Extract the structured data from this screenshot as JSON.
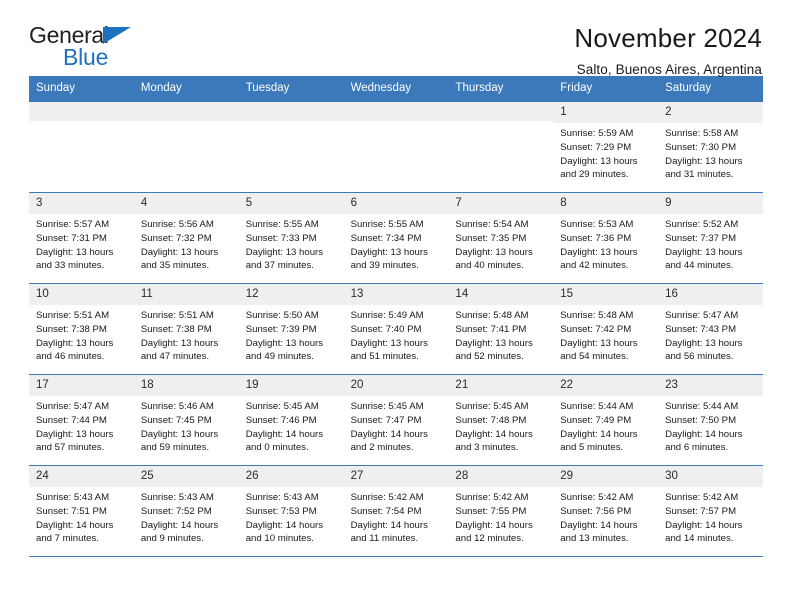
{
  "logo": {
    "line1": "General",
    "line2": "Blue",
    "triangle_color": "#1e72bd"
  },
  "header": {
    "title": "November 2024",
    "location": "Salto, Buenos Aires, Argentina"
  },
  "theme": {
    "header_bg": "#3b79ba",
    "daynum_bg": "#efefef",
    "rule_color": "#3b79ba"
  },
  "calendar": {
    "weekday_headers": [
      "Sunday",
      "Monday",
      "Tuesday",
      "Wednesday",
      "Thursday",
      "Friday",
      "Saturday"
    ],
    "weeks": [
      [
        {
          "day": "",
          "empty": true
        },
        {
          "day": "",
          "empty": true
        },
        {
          "day": "",
          "empty": true
        },
        {
          "day": "",
          "empty": true
        },
        {
          "day": "",
          "empty": true
        },
        {
          "day": "1",
          "sunrise": "Sunrise: 5:59 AM",
          "sunset": "Sunset: 7:29 PM",
          "daylight": "Daylight: 13 hours and 29 minutes."
        },
        {
          "day": "2",
          "sunrise": "Sunrise: 5:58 AM",
          "sunset": "Sunset: 7:30 PM",
          "daylight": "Daylight: 13 hours and 31 minutes."
        }
      ],
      [
        {
          "day": "3",
          "sunrise": "Sunrise: 5:57 AM",
          "sunset": "Sunset: 7:31 PM",
          "daylight": "Daylight: 13 hours and 33 minutes."
        },
        {
          "day": "4",
          "sunrise": "Sunrise: 5:56 AM",
          "sunset": "Sunset: 7:32 PM",
          "daylight": "Daylight: 13 hours and 35 minutes."
        },
        {
          "day": "5",
          "sunrise": "Sunrise: 5:55 AM",
          "sunset": "Sunset: 7:33 PM",
          "daylight": "Daylight: 13 hours and 37 minutes."
        },
        {
          "day": "6",
          "sunrise": "Sunrise: 5:55 AM",
          "sunset": "Sunset: 7:34 PM",
          "daylight": "Daylight: 13 hours and 39 minutes."
        },
        {
          "day": "7",
          "sunrise": "Sunrise: 5:54 AM",
          "sunset": "Sunset: 7:35 PM",
          "daylight": "Daylight: 13 hours and 40 minutes."
        },
        {
          "day": "8",
          "sunrise": "Sunrise: 5:53 AM",
          "sunset": "Sunset: 7:36 PM",
          "daylight": "Daylight: 13 hours and 42 minutes."
        },
        {
          "day": "9",
          "sunrise": "Sunrise: 5:52 AM",
          "sunset": "Sunset: 7:37 PM",
          "daylight": "Daylight: 13 hours and 44 minutes."
        }
      ],
      [
        {
          "day": "10",
          "sunrise": "Sunrise: 5:51 AM",
          "sunset": "Sunset: 7:38 PM",
          "daylight": "Daylight: 13 hours and 46 minutes."
        },
        {
          "day": "11",
          "sunrise": "Sunrise: 5:51 AM",
          "sunset": "Sunset: 7:38 PM",
          "daylight": "Daylight: 13 hours and 47 minutes."
        },
        {
          "day": "12",
          "sunrise": "Sunrise: 5:50 AM",
          "sunset": "Sunset: 7:39 PM",
          "daylight": "Daylight: 13 hours and 49 minutes."
        },
        {
          "day": "13",
          "sunrise": "Sunrise: 5:49 AM",
          "sunset": "Sunset: 7:40 PM",
          "daylight": "Daylight: 13 hours and 51 minutes."
        },
        {
          "day": "14",
          "sunrise": "Sunrise: 5:48 AM",
          "sunset": "Sunset: 7:41 PM",
          "daylight": "Daylight: 13 hours and 52 minutes."
        },
        {
          "day": "15",
          "sunrise": "Sunrise: 5:48 AM",
          "sunset": "Sunset: 7:42 PM",
          "daylight": "Daylight: 13 hours and 54 minutes."
        },
        {
          "day": "16",
          "sunrise": "Sunrise: 5:47 AM",
          "sunset": "Sunset: 7:43 PM",
          "daylight": "Daylight: 13 hours and 56 minutes."
        }
      ],
      [
        {
          "day": "17",
          "sunrise": "Sunrise: 5:47 AM",
          "sunset": "Sunset: 7:44 PM",
          "daylight": "Daylight: 13 hours and 57 minutes."
        },
        {
          "day": "18",
          "sunrise": "Sunrise: 5:46 AM",
          "sunset": "Sunset: 7:45 PM",
          "daylight": "Daylight: 13 hours and 59 minutes."
        },
        {
          "day": "19",
          "sunrise": "Sunrise: 5:45 AM",
          "sunset": "Sunset: 7:46 PM",
          "daylight": "Daylight: 14 hours and 0 minutes."
        },
        {
          "day": "20",
          "sunrise": "Sunrise: 5:45 AM",
          "sunset": "Sunset: 7:47 PM",
          "daylight": "Daylight: 14 hours and 2 minutes."
        },
        {
          "day": "21",
          "sunrise": "Sunrise: 5:45 AM",
          "sunset": "Sunset: 7:48 PM",
          "daylight": "Daylight: 14 hours and 3 minutes."
        },
        {
          "day": "22",
          "sunrise": "Sunrise: 5:44 AM",
          "sunset": "Sunset: 7:49 PM",
          "daylight": "Daylight: 14 hours and 5 minutes."
        },
        {
          "day": "23",
          "sunrise": "Sunrise: 5:44 AM",
          "sunset": "Sunset: 7:50 PM",
          "daylight": "Daylight: 14 hours and 6 minutes."
        }
      ],
      [
        {
          "day": "24",
          "sunrise": "Sunrise: 5:43 AM",
          "sunset": "Sunset: 7:51 PM",
          "daylight": "Daylight: 14 hours and 7 minutes."
        },
        {
          "day": "25",
          "sunrise": "Sunrise: 5:43 AM",
          "sunset": "Sunset: 7:52 PM",
          "daylight": "Daylight: 14 hours and 9 minutes."
        },
        {
          "day": "26",
          "sunrise": "Sunrise: 5:43 AM",
          "sunset": "Sunset: 7:53 PM",
          "daylight": "Daylight: 14 hours and 10 minutes."
        },
        {
          "day": "27",
          "sunrise": "Sunrise: 5:42 AM",
          "sunset": "Sunset: 7:54 PM",
          "daylight": "Daylight: 14 hours and 11 minutes."
        },
        {
          "day": "28",
          "sunrise": "Sunrise: 5:42 AM",
          "sunset": "Sunset: 7:55 PM",
          "daylight": "Daylight: 14 hours and 12 minutes."
        },
        {
          "day": "29",
          "sunrise": "Sunrise: 5:42 AM",
          "sunset": "Sunset: 7:56 PM",
          "daylight": "Daylight: 14 hours and 13 minutes."
        },
        {
          "day": "30",
          "sunrise": "Sunrise: 5:42 AM",
          "sunset": "Sunset: 7:57 PM",
          "daylight": "Daylight: 14 hours and 14 minutes."
        }
      ]
    ]
  }
}
